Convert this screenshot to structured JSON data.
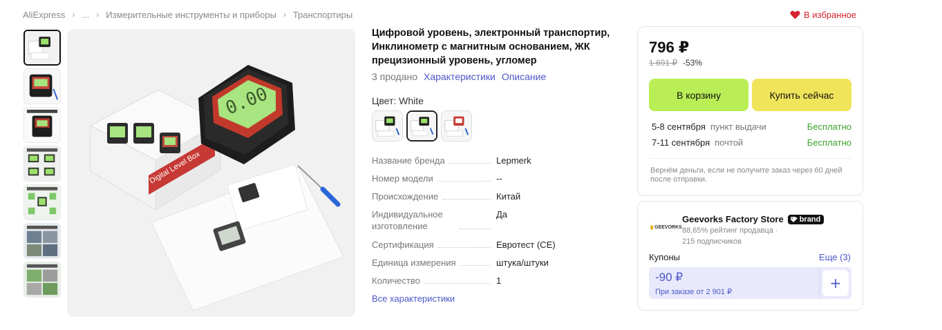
{
  "breadcrumb": {
    "items": [
      "AliExpress",
      "...",
      "Измерительные инструменты и приборы",
      "Транспортиры"
    ]
  },
  "favorite": {
    "label": "В избранное",
    "icon": "heart-icon",
    "color": "#d6232f"
  },
  "product": {
    "title": "Цифровой уровень, электронный транспортир, Инклинометр с магнитным основанием, ЖК прецизионный уровень, угломер",
    "sold": "3 продано",
    "tabs": [
      "Характеристики",
      "Описание"
    ],
    "color_label": "Цвет: White",
    "main_image_text": "Digital Level Box",
    "specs": [
      {
        "name": "Название бренда",
        "value": "Lepmerk"
      },
      {
        "name": "Номер модели",
        "value": "--"
      },
      {
        "name": "Происхождение",
        "value": "Китай"
      },
      {
        "name": "Индивидуальное изготовление",
        "value": "Да"
      },
      {
        "name": "Сертификация",
        "value": "Евротест (CE)"
      },
      {
        "name": "Единица измерения",
        "value": "штука/штуки"
      },
      {
        "name": "Количество",
        "value": "1"
      }
    ],
    "all_specs": "Все характеристики"
  },
  "buy": {
    "price": "796 ₽",
    "old_price": "1 691 ₽",
    "discount": "-53%",
    "cart_label": "В корзину",
    "buy_label": "Купить сейчас",
    "delivery": [
      {
        "date": "5-8 сентября",
        "kind": "пункт выдачи",
        "cost": "Бесплатно"
      },
      {
        "date": "7-11 сентября",
        "kind": "почтой",
        "cost": "Бесплатно"
      }
    ],
    "refund": "Вернём деньги, если не получите заказ через 60 дней после отправки."
  },
  "store": {
    "logo_text": "GEEVORKS",
    "name": "Geevorks Factory Store",
    "badge": "brand",
    "rating": "88,65% рейтинг продавца ·",
    "followers": "215 подписчиков",
    "coupons_label": "Купоны",
    "coupons_more": "Еще (3)",
    "coupon_amount": "-90 ₽",
    "coupon_condition": "При заказе от 2 901 ₽",
    "coupon_add": "+"
  },
  "colors": {
    "cart_button": "#b9ee56",
    "buy_button": "#f0e45a",
    "link": "#4c56c7",
    "free": "#3ba32b"
  }
}
